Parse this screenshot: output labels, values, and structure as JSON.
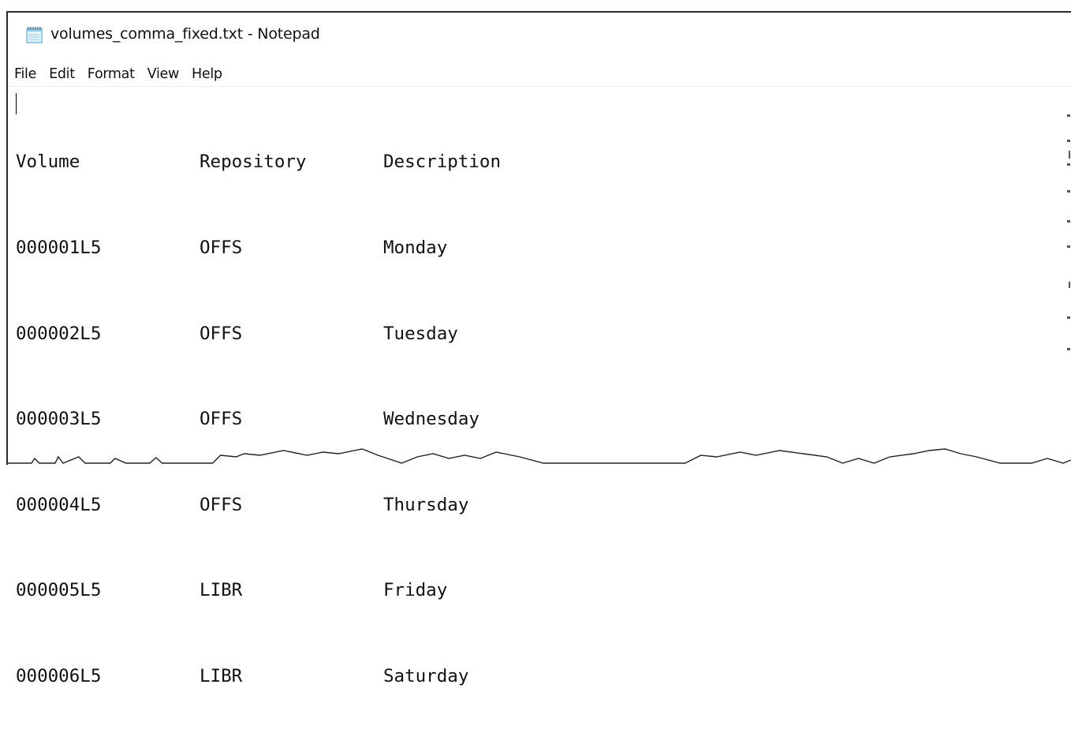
{
  "window": {
    "title": "volumes_comma_fixed.txt - Notepad",
    "icon": "notepad-icon"
  },
  "menu": {
    "items": [
      {
        "label": "File"
      },
      {
        "label": "Edit"
      },
      {
        "label": "Format"
      },
      {
        "label": "View"
      },
      {
        "label": "Help"
      }
    ]
  },
  "document": {
    "rows": [
      [
        "Volume",
        "Repository",
        "Description"
      ],
      [
        "000001L5",
        "OFFS",
        "Monday"
      ],
      [
        "000002L5",
        "OFFS",
        "Tuesday"
      ],
      [
        "000003L5",
        "OFFS",
        "Wednesday"
      ],
      [
        "000004L5",
        "OFFS",
        "Thursday"
      ],
      [
        "000005L5",
        "LIBR",
        "Friday"
      ],
      [
        "000006L5",
        "LIBR",
        "Saturday"
      ]
    ]
  }
}
